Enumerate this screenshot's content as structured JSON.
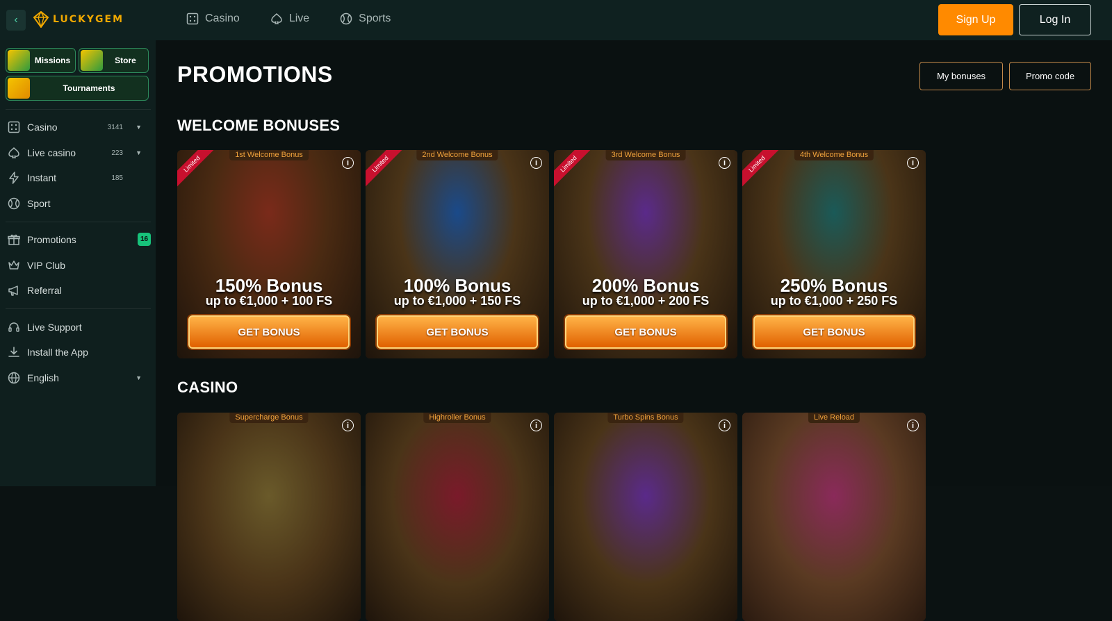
{
  "header": {
    "logo_text": "LUCKYGEM",
    "nav": [
      {
        "label": "Casino",
        "icon": "dice-icon"
      },
      {
        "label": "Live",
        "icon": "spade-icon"
      },
      {
        "label": "Sports",
        "icon": "ball-icon"
      }
    ],
    "signup_label": "Sign Up",
    "login_label": "Log In",
    "accent_color": "#ff8a00"
  },
  "sidebar": {
    "quick_links": [
      "Missions",
      "Store",
      "Tournaments"
    ],
    "games": [
      {
        "label": "Casino",
        "count": "3141",
        "icon": "dice-icon"
      },
      {
        "label": "Live casino",
        "count": "223",
        "icon": "spade-icon"
      },
      {
        "label": "Instant",
        "count": "185",
        "icon": "bolt-icon"
      },
      {
        "label": "Sport",
        "count": "",
        "icon": "ball-icon"
      }
    ],
    "features": [
      {
        "label": "Promotions",
        "badge": "16",
        "icon": "gift-icon"
      },
      {
        "label": "VIP Club",
        "icon": "crown-icon"
      },
      {
        "label": "Referral",
        "icon": "megaphone-icon"
      }
    ],
    "support": [
      {
        "label": "Live Support",
        "icon": "headset-icon"
      },
      {
        "label": "Install the App",
        "icon": "download-icon"
      },
      {
        "label": "English",
        "icon": "globe-icon"
      }
    ]
  },
  "main": {
    "title": "PROMOTIONS",
    "my_bonuses_label": "My bonuses",
    "promo_code_label": "Promo code",
    "welcome_section": "WELCOME BONUSES",
    "casino_section": "CASINO",
    "ribbon_label": "Limited",
    "cta_label": "GET BONUS",
    "welcome_cards": [
      {
        "tag": "1st Welcome Bonus",
        "headline": "150% Bonus",
        "subline": "up to €1,000 + 100 FS",
        "tone": "#7a2a1a"
      },
      {
        "tag": "2nd Welcome Bonus",
        "headline": "100% Bonus",
        "subline": "up to €1,000 + 150 FS",
        "tone": "#1a4a8a"
      },
      {
        "tag": "3rd Welcome Bonus",
        "headline": "200% Bonus",
        "subline": "up to €1,000 + 200 FS",
        "tone": "#5a2a8a"
      },
      {
        "tag": "4th Welcome Bonus",
        "headline": "250% Bonus",
        "subline": "up to €1,000 + 250 FS",
        "tone": "#1a5a58"
      }
    ],
    "casino_cards": [
      {
        "tag": "Supercharge Bonus",
        "tone": "#6a5a2a"
      },
      {
        "tag": "Highroller Bonus",
        "tone": "#7a1a2a"
      },
      {
        "tag": "Turbo Spins Bonus",
        "tone": "#5a2a8a"
      },
      {
        "tag": "Live Reload",
        "tone": "#8a2a5a"
      }
    ]
  }
}
